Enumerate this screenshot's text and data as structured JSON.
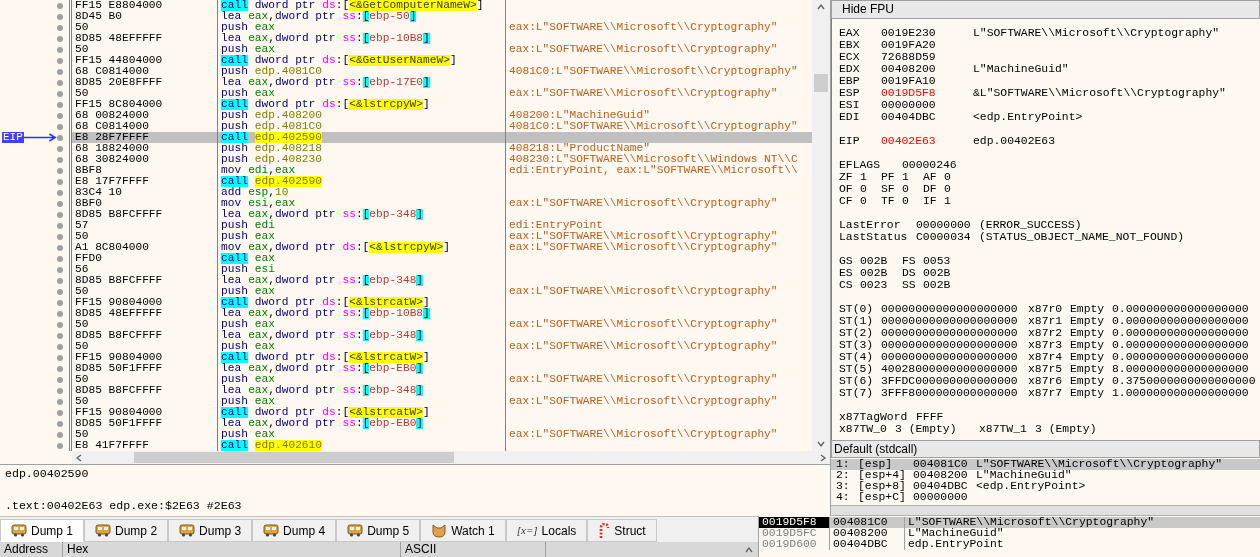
{
  "disassembly": {
    "eip_label": "EIP",
    "rows": [
      {
        "bytes": "FF15 E8804000",
        "selected": false,
        "ops": [
          {
            "kind": "call",
            "text": "call"
          },
          {
            "kind": "size",
            "text": "dword ptr"
          },
          {
            "kind": "seg",
            "text": "ds"
          },
          {
            "kind": "punct",
            "text": ":["
          },
          {
            "kind": "symbol",
            "text": "<&GetComputerNameW>"
          },
          {
            "kind": "punct",
            "text": "]"
          }
        ]
      },
      {
        "bytes": "8D45 B0",
        "selected": false,
        "ops": [
          {
            "kind": "mnemonic",
            "text": "lea"
          },
          {
            "kind": "reg",
            "text": "eax"
          },
          {
            "kind": "punct",
            "text": ","
          },
          {
            "kind": "size",
            "text": "dword ptr"
          },
          {
            "kind": "seg",
            "text": "ss"
          },
          {
            "kind": "punct",
            "text": ":"
          },
          {
            "kind": "bracket",
            "text": "["
          },
          {
            "kind": "offset",
            "text": "ebp-50"
          },
          {
            "kind": "bracket",
            "text": "]"
          }
        ]
      },
      {
        "bytes": "50",
        "selected": false,
        "ops": [
          {
            "kind": "mnemonic",
            "text": "push"
          },
          {
            "kind": "reg",
            "text": "eax"
          }
        ],
        "comment": "eax:L\"SOFTWARE\\\\Microsoft\\\\Cryptography\""
      },
      {
        "bytes": "8D85 48EFFFFF",
        "selected": false,
        "ops": [
          {
            "kind": "mnemonic",
            "text": "lea"
          },
          {
            "kind": "reg",
            "text": "eax"
          },
          {
            "kind": "punct",
            "text": ","
          },
          {
            "kind": "size",
            "text": "dword ptr"
          },
          {
            "kind": "seg",
            "text": "ss"
          },
          {
            "kind": "punct",
            "text": ":"
          },
          {
            "kind": "bracket",
            "text": "["
          },
          {
            "kind": "offset",
            "text": "ebp-10B8"
          },
          {
            "kind": "bracket",
            "text": "]"
          }
        ]
      },
      {
        "bytes": "50",
        "selected": false,
        "ops": [
          {
            "kind": "mnemonic",
            "text": "push"
          },
          {
            "kind": "reg",
            "text": "eax"
          }
        ],
        "comment": "eax:L\"SOFTWARE\\\\Microsoft\\\\Cryptography\""
      },
      {
        "bytes": "FF15 44804000",
        "selected": false,
        "ops": [
          {
            "kind": "call",
            "text": "call"
          },
          {
            "kind": "size",
            "text": "dword ptr"
          },
          {
            "kind": "seg",
            "text": "ds"
          },
          {
            "kind": "punct",
            "text": ":["
          },
          {
            "kind": "symbol",
            "text": "<&GetUserNameW>"
          },
          {
            "kind": "punct",
            "text": "]"
          }
        ]
      },
      {
        "bytes": "68 C0814000",
        "selected": false,
        "ops": [
          {
            "kind": "mnemonic",
            "text": "push"
          },
          {
            "kind": "address",
            "text": "edp.4081C0"
          }
        ],
        "comment": "4081C0:L\"SOFTWARE\\\\Microsoft\\\\Cryptography\""
      },
      {
        "bytes": "8D85 20E8FFFF",
        "selected": false,
        "ops": [
          {
            "kind": "mnemonic",
            "text": "lea"
          },
          {
            "kind": "reg",
            "text": "eax"
          },
          {
            "kind": "punct",
            "text": ","
          },
          {
            "kind": "size",
            "text": "dword ptr"
          },
          {
            "kind": "seg",
            "text": "ss"
          },
          {
            "kind": "punct",
            "text": ":"
          },
          {
            "kind": "bracket",
            "text": "["
          },
          {
            "kind": "offset",
            "text": "ebp-17E0"
          },
          {
            "kind": "bracket",
            "text": "]"
          }
        ]
      },
      {
        "bytes": "50",
        "selected": false,
        "ops": [
          {
            "kind": "mnemonic",
            "text": "push"
          },
          {
            "kind": "reg",
            "text": "eax"
          }
        ],
        "comment": "eax:L\"SOFTWARE\\\\Microsoft\\\\Cryptography\""
      },
      {
        "bytes": "FF15 8C804000",
        "selected": false,
        "ops": [
          {
            "kind": "call",
            "text": "call"
          },
          {
            "kind": "size",
            "text": "dword ptr"
          },
          {
            "kind": "seg",
            "text": "ds"
          },
          {
            "kind": "punct",
            "text": ":["
          },
          {
            "kind": "symbol",
            "text": "<&lstrcpyW>"
          },
          {
            "kind": "punct",
            "text": "]"
          }
        ]
      },
      {
        "bytes": "68 00824000",
        "selected": false,
        "ops": [
          {
            "kind": "mnemonic",
            "text": "push"
          },
          {
            "kind": "address",
            "text": "edp.408200"
          }
        ],
        "comment": "408200:L\"MachineGuid\""
      },
      {
        "bytes": "68 C0814000",
        "selected": false,
        "ops": [
          {
            "kind": "mnemonic",
            "text": "push"
          },
          {
            "kind": "address",
            "text": "edp.4081C0"
          }
        ],
        "comment": "4081C0:L\"SOFTWARE\\\\Microsoft\\\\Cryptography\""
      },
      {
        "bytes": "E8 28F7FFFF",
        "selected": true,
        "ops": [
          {
            "kind": "call",
            "text": "call"
          },
          {
            "kind": "target",
            "text": "edp.402590"
          }
        ]
      },
      {
        "bytes": "68 18824000",
        "selected": false,
        "ops": [
          {
            "kind": "mnemonic",
            "text": "push"
          },
          {
            "kind": "address",
            "text": "edp.408218"
          }
        ],
        "comment": "408218:L\"ProductName\""
      },
      {
        "bytes": "68 30824000",
        "selected": false,
        "ops": [
          {
            "kind": "mnemonic",
            "text": "push"
          },
          {
            "kind": "address",
            "text": "edp.408230"
          }
        ],
        "comment": "408230:L\"SOFTWARE\\\\Microsoft\\\\Windows NT\\\\C"
      },
      {
        "bytes": "8BF8",
        "selected": false,
        "ops": [
          {
            "kind": "mnemonic",
            "text": "mov"
          },
          {
            "kind": "reg",
            "text": "edi"
          },
          {
            "kind": "punct",
            "text": ","
          },
          {
            "kind": "reg",
            "text": "eax"
          }
        ],
        "comment": "edi:EntryPoint, eax:L\"SOFTWARE\\\\Microsoft\\\\"
      },
      {
        "bytes": "E8 17F7FFFF",
        "selected": false,
        "ops": [
          {
            "kind": "call",
            "text": "call"
          },
          {
            "kind": "target",
            "text": "edp.402590"
          }
        ]
      },
      {
        "bytes": "83C4 10",
        "selected": false,
        "ops": [
          {
            "kind": "mnemonic",
            "text": "add"
          },
          {
            "kind": "reg",
            "text": "esp"
          },
          {
            "kind": "punct",
            "text": ","
          },
          {
            "kind": "imm",
            "text": "10"
          }
        ]
      },
      {
        "bytes": "8BF0",
        "selected": false,
        "ops": [
          {
            "kind": "mnemonic",
            "text": "mov"
          },
          {
            "kind": "reg",
            "text": "esi"
          },
          {
            "kind": "punct",
            "text": ","
          },
          {
            "kind": "reg",
            "text": "eax"
          }
        ],
        "comment": "eax:L\"SOFTWARE\\\\Microsoft\\\\Cryptography\""
      },
      {
        "bytes": "8D85 B8FCFFFF",
        "selected": false,
        "ops": [
          {
            "kind": "mnemonic",
            "text": "lea"
          },
          {
            "kind": "reg",
            "text": "eax"
          },
          {
            "kind": "punct",
            "text": ","
          },
          {
            "kind": "size",
            "text": "dword ptr"
          },
          {
            "kind": "seg",
            "text": "ss"
          },
          {
            "kind": "punct",
            "text": ":"
          },
          {
            "kind": "bracket",
            "text": "["
          },
          {
            "kind": "offset",
            "text": "ebp-348"
          },
          {
            "kind": "bracket",
            "text": "]"
          }
        ]
      },
      {
        "bytes": "57",
        "selected": false,
        "ops": [
          {
            "kind": "mnemonic",
            "text": "push"
          },
          {
            "kind": "reg",
            "text": "edi"
          }
        ],
        "comment": "edi:EntryPoint"
      },
      {
        "bytes": "50",
        "selected": false,
        "ops": [
          {
            "kind": "mnemonic",
            "text": "push"
          },
          {
            "kind": "reg",
            "text": "eax"
          }
        ],
        "comment": "eax:L\"SOFTWARE\\\\Microsoft\\\\Cryptography\""
      },
      {
        "bytes": "A1 8C804000",
        "selected": false,
        "ops": [
          {
            "kind": "mnemonic",
            "text": "mov"
          },
          {
            "kind": "reg",
            "text": "eax"
          },
          {
            "kind": "punct",
            "text": ","
          },
          {
            "kind": "size",
            "text": "dword ptr"
          },
          {
            "kind": "seg",
            "text": "ds"
          },
          {
            "kind": "punct",
            "text": ":["
          },
          {
            "kind": "symbol",
            "text": "<&lstrcpyW>"
          },
          {
            "kind": "punct",
            "text": "]"
          }
        ],
        "comment": "eax:L\"SOFTWARE\\\\Microsoft\\\\Cryptography\""
      },
      {
        "bytes": "FFD0",
        "selected": false,
        "ops": [
          {
            "kind": "call",
            "text": "call"
          },
          {
            "kind": "reg",
            "text": "eax"
          }
        ]
      },
      {
        "bytes": "56",
        "selected": false,
        "ops": [
          {
            "kind": "mnemonic",
            "text": "push"
          },
          {
            "kind": "reg",
            "text": "esi"
          }
        ]
      },
      {
        "bytes": "8D85 B8FCFFFF",
        "selected": false,
        "ops": [
          {
            "kind": "mnemonic",
            "text": "lea"
          },
          {
            "kind": "reg",
            "text": "eax"
          },
          {
            "kind": "punct",
            "text": ","
          },
          {
            "kind": "size",
            "text": "dword ptr"
          },
          {
            "kind": "seg",
            "text": "ss"
          },
          {
            "kind": "punct",
            "text": ":"
          },
          {
            "kind": "bracket",
            "text": "["
          },
          {
            "kind": "offset",
            "text": "ebp-348"
          },
          {
            "kind": "bracket",
            "text": "]"
          }
        ]
      },
      {
        "bytes": "50",
        "selected": false,
        "ops": [
          {
            "kind": "mnemonic",
            "text": "push"
          },
          {
            "kind": "reg",
            "text": "eax"
          }
        ],
        "comment": "eax:L\"SOFTWARE\\\\Microsoft\\\\Cryptography\""
      },
      {
        "bytes": "FF15 90804000",
        "selected": false,
        "ops": [
          {
            "kind": "call",
            "text": "call"
          },
          {
            "kind": "size",
            "text": "dword ptr"
          },
          {
            "kind": "seg",
            "text": "ds"
          },
          {
            "kind": "punct",
            "text": ":["
          },
          {
            "kind": "symbol",
            "text": "<&lstrcatW>"
          },
          {
            "kind": "punct",
            "text": "]"
          }
        ]
      },
      {
        "bytes": "8D85 48EFFFFF",
        "selected": false,
        "ops": [
          {
            "kind": "mnemonic",
            "text": "lea"
          },
          {
            "kind": "reg",
            "text": "eax"
          },
          {
            "kind": "punct",
            "text": ","
          },
          {
            "kind": "size",
            "text": "dword ptr"
          },
          {
            "kind": "seg",
            "text": "ss"
          },
          {
            "kind": "punct",
            "text": ":"
          },
          {
            "kind": "bracket",
            "text": "["
          },
          {
            "kind": "offset",
            "text": "ebp-10B8"
          },
          {
            "kind": "bracket",
            "text": "]"
          }
        ]
      },
      {
        "bytes": "50",
        "selected": false,
        "ops": [
          {
            "kind": "mnemonic",
            "text": "push"
          },
          {
            "kind": "reg",
            "text": "eax"
          }
        ],
        "comment": "eax:L\"SOFTWARE\\\\Microsoft\\\\Cryptography\""
      },
      {
        "bytes": "8D85 B8FCFFFF",
        "selected": false,
        "ops": [
          {
            "kind": "mnemonic",
            "text": "lea"
          },
          {
            "kind": "reg",
            "text": "eax"
          },
          {
            "kind": "punct",
            "text": ","
          },
          {
            "kind": "size",
            "text": "dword ptr"
          },
          {
            "kind": "seg",
            "text": "ss"
          },
          {
            "kind": "punct",
            "text": ":"
          },
          {
            "kind": "bracket",
            "text": "["
          },
          {
            "kind": "offset",
            "text": "ebp-348"
          },
          {
            "kind": "bracket",
            "text": "]"
          }
        ]
      },
      {
        "bytes": "50",
        "selected": false,
        "ops": [
          {
            "kind": "mnemonic",
            "text": "push"
          },
          {
            "kind": "reg",
            "text": "eax"
          }
        ],
        "comment": "eax:L\"SOFTWARE\\\\Microsoft\\\\Cryptography\""
      },
      {
        "bytes": "FF15 90804000",
        "selected": false,
        "ops": [
          {
            "kind": "call",
            "text": "call"
          },
          {
            "kind": "size",
            "text": "dword ptr"
          },
          {
            "kind": "seg",
            "text": "ds"
          },
          {
            "kind": "punct",
            "text": ":["
          },
          {
            "kind": "symbol",
            "text": "<&lstrcatW>"
          },
          {
            "kind": "punct",
            "text": "]"
          }
        ]
      },
      {
        "bytes": "8D85 50F1FFFF",
        "selected": false,
        "ops": [
          {
            "kind": "mnemonic",
            "text": "lea"
          },
          {
            "kind": "reg",
            "text": "eax"
          },
          {
            "kind": "punct",
            "text": ","
          },
          {
            "kind": "size",
            "text": "dword ptr"
          },
          {
            "kind": "seg",
            "text": "ss"
          },
          {
            "kind": "punct",
            "text": ":"
          },
          {
            "kind": "bracket",
            "text": "["
          },
          {
            "kind": "offset",
            "text": "ebp-EB0"
          },
          {
            "kind": "bracket",
            "text": "]"
          }
        ]
      },
      {
        "bytes": "50",
        "selected": false,
        "ops": [
          {
            "kind": "mnemonic",
            "text": "push"
          },
          {
            "kind": "reg",
            "text": "eax"
          }
        ],
        "comment": "eax:L\"SOFTWARE\\\\Microsoft\\\\Cryptography\""
      },
      {
        "bytes": "8D85 B8FCFFFF",
        "selected": false,
        "ops": [
          {
            "kind": "mnemonic",
            "text": "lea"
          },
          {
            "kind": "reg",
            "text": "eax"
          },
          {
            "kind": "punct",
            "text": ","
          },
          {
            "kind": "size",
            "text": "dword ptr"
          },
          {
            "kind": "seg",
            "text": "ss"
          },
          {
            "kind": "punct",
            "text": ":"
          },
          {
            "kind": "bracket",
            "text": "["
          },
          {
            "kind": "offset",
            "text": "ebp-348"
          },
          {
            "kind": "bracket",
            "text": "]"
          }
        ]
      },
      {
        "bytes": "50",
        "selected": false,
        "ops": [
          {
            "kind": "mnemonic",
            "text": "push"
          },
          {
            "kind": "reg",
            "text": "eax"
          }
        ],
        "comment": "eax:L\"SOFTWARE\\\\Microsoft\\\\Cryptography\""
      },
      {
        "bytes": "FF15 90804000",
        "selected": false,
        "ops": [
          {
            "kind": "call",
            "text": "call"
          },
          {
            "kind": "size",
            "text": "dword ptr"
          },
          {
            "kind": "seg",
            "text": "ds"
          },
          {
            "kind": "punct",
            "text": ":["
          },
          {
            "kind": "symbol",
            "text": "<&lstrcatW>"
          },
          {
            "kind": "punct",
            "text": "]"
          }
        ]
      },
      {
        "bytes": "8D85 50F1FFFF",
        "selected": false,
        "ops": [
          {
            "kind": "mnemonic",
            "text": "lea"
          },
          {
            "kind": "reg",
            "text": "eax"
          },
          {
            "kind": "punct",
            "text": ","
          },
          {
            "kind": "size",
            "text": "dword ptr"
          },
          {
            "kind": "seg",
            "text": "ss"
          },
          {
            "kind": "punct",
            "text": ":"
          },
          {
            "kind": "bracket",
            "text": "["
          },
          {
            "kind": "offset",
            "text": "ebp-EB0"
          },
          {
            "kind": "bracket",
            "text": "]"
          }
        ]
      },
      {
        "bytes": "50",
        "selected": false,
        "ops": [
          {
            "kind": "mnemonic",
            "text": "push"
          },
          {
            "kind": "reg",
            "text": "eax"
          }
        ],
        "comment": "eax:L\"SOFTWARE\\\\Microsoft\\\\Cryptography\""
      },
      {
        "bytes": "E8 41F7FFFF",
        "selected": false,
        "ops": [
          {
            "kind": "call",
            "text": "call"
          },
          {
            "kind": "target",
            "text": "edp.402610"
          }
        ]
      }
    ]
  },
  "info": {
    "lines": [
      "edp.00402590",
      ".text:00402E63 edp.exe:$2E63 #2E63"
    ]
  },
  "tabs": [
    {
      "label": "Dump 1",
      "kind": "dump",
      "selected": true
    },
    {
      "label": "Dump 2",
      "kind": "dump",
      "selected": false
    },
    {
      "label": "Dump 3",
      "kind": "dump",
      "selected": false
    },
    {
      "label": "Dump 4",
      "kind": "dump",
      "selected": false
    },
    {
      "label": "Dump 5",
      "kind": "dump",
      "selected": false
    },
    {
      "label": "Watch 1",
      "kind": "watch",
      "selected": false
    },
    {
      "label": "Locals",
      "kind": "locals",
      "glyph": "[x=]",
      "selected": false
    },
    {
      "label": "Struct",
      "kind": "struct",
      "selected": false
    }
  ],
  "dump_header": {
    "columns": [
      "Address",
      "Hex",
      "ASCII"
    ]
  },
  "registers": {
    "toggle_button": "Hide FPU",
    "general": [
      {
        "name": "EAX",
        "value": "0019E230",
        "changed": false,
        "comment": "L\"SOFTWARE\\\\Microsoft\\\\Cryptography\""
      },
      {
        "name": "EBX",
        "value": "0019FA20",
        "changed": false
      },
      {
        "name": "ECX",
        "value": "72688D59",
        "changed": false
      },
      {
        "name": "EDX",
        "value": "00408200",
        "changed": false,
        "comment": "L\"MachineGuid\""
      },
      {
        "name": "EBP",
        "value": "0019FA10",
        "changed": false
      },
      {
        "name": "ESP",
        "value": "0019D5F8",
        "changed": true,
        "comment": "&L\"SOFTWARE\\\\Microsoft\\\\Cryptography\""
      },
      {
        "name": "ESI",
        "value": "00000000",
        "changed": false
      },
      {
        "name": "EDI",
        "value": "00404DBC",
        "changed": false,
        "comment": "<edp.EntryPoint>"
      }
    ],
    "eip": {
      "name": "EIP",
      "value": "00402E63",
      "changed": true,
      "comment": "edp.00402E63"
    },
    "eflags": {
      "name": "EFLAGS",
      "value": "00000246"
    },
    "flags": [
      [
        {
          "name": "ZF",
          "value": "1"
        },
        {
          "name": "PF",
          "value": "1"
        },
        {
          "name": "AF",
          "value": "0"
        }
      ],
      [
        {
          "name": "OF",
          "value": "0"
        },
        {
          "name": "SF",
          "value": "0"
        },
        {
          "name": "DF",
          "value": "0"
        }
      ],
      [
        {
          "name": "CF",
          "value": "0"
        },
        {
          "name": "TF",
          "value": "0"
        },
        {
          "name": "IF",
          "value": "1"
        }
      ]
    ],
    "last": [
      {
        "name": "LastError",
        "value": "00000000",
        "comment": "(ERROR_SUCCESS)"
      },
      {
        "name": "LastStatus",
        "value": "C0000034",
        "comment": "(STATUS_OBJECT_NAME_NOT_FOUND)"
      }
    ],
    "segments": [
      [
        {
          "name": "GS",
          "value": "002B"
        },
        {
          "name": "FS",
          "value": "0053"
        }
      ],
      [
        {
          "name": "ES",
          "value": "002B"
        },
        {
          "name": "DS",
          "value": "002B"
        }
      ],
      [
        {
          "name": "CS",
          "value": "0023"
        },
        {
          "name": "SS",
          "value": "002B"
        }
      ]
    ],
    "fpu": [
      {
        "name": "ST(0)",
        "raw": "00000000000000000000",
        "reg": "x87r0",
        "tag": "Empty",
        "value": "0.000000000000000000"
      },
      {
        "name": "ST(1)",
        "raw": "00000000000000000000",
        "reg": "x87r1",
        "tag": "Empty",
        "value": "0.000000000000000000"
      },
      {
        "name": "ST(2)",
        "raw": "00000000000000000000",
        "reg": "x87r2",
        "tag": "Empty",
        "value": "0.000000000000000000"
      },
      {
        "name": "ST(3)",
        "raw": "00000000000000000000",
        "reg": "x87r3",
        "tag": "Empty",
        "value": "0.000000000000000000"
      },
      {
        "name": "ST(4)",
        "raw": "00000000000000000000",
        "reg": "x87r4",
        "tag": "Empty",
        "value": "0.000000000000000000"
      },
      {
        "name": "ST(5)",
        "raw": "40028000000000000000",
        "reg": "x87r5",
        "tag": "Empty",
        "value": "8.000000000000000000"
      },
      {
        "name": "ST(6)",
        "raw": "3FFDC000000000000000",
        "reg": "x87r6",
        "tag": "Empty",
        "value": "0.3750000000000000000"
      },
      {
        "name": "ST(7)",
        "raw": "3FFF8000000000000000",
        "reg": "x87r7",
        "tag": "Empty",
        "value": "1.000000000000000000"
      }
    ],
    "tag_word": {
      "name": "x87TagWord",
      "value": "FFFF"
    },
    "tag_entries": [
      {
        "name": "x87TW_0",
        "value": "3 (Empty)"
      },
      {
        "name": "x87TW_1",
        "value": "3 (Empty)"
      }
    ]
  },
  "call_convention": "Default (stdcall)",
  "arguments": [
    {
      "index": "1:",
      "location": "[esp]",
      "value": "004081C0",
      "comment": "L\"SOFTWARE\\\\Microsoft\\\\Cryptography\"",
      "selected": true
    },
    {
      "index": "2:",
      "location": "[esp+4]",
      "value": "00408200",
      "comment": "L\"MachineGuid\"",
      "selected": false
    },
    {
      "index": "3:",
      "location": "[esp+8]",
      "value": "00404DBC",
      "comment": "<edp.EntryPoint>",
      "selected": false
    },
    {
      "index": "4:",
      "location": "[esp+C]",
      "value": "00000000",
      "selected": false
    }
  ],
  "stack": [
    {
      "address": "0019D5F8",
      "value": "004081C0",
      "comment": "L\"SOFTWARE\\\\Microsoft\\\\Cryptography\"",
      "selected": true
    },
    {
      "address": "0019D5FC",
      "value": "00408200",
      "comment": "L\"MachineGuid\"",
      "selected": false
    },
    {
      "address": "0019D600",
      "value": "00404DBC",
      "comment": "edp.EntryPoint",
      "selected": false
    }
  ]
}
